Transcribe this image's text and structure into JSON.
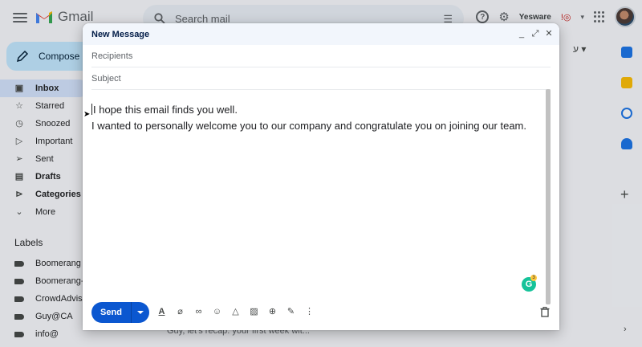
{
  "app": {
    "logo_text": "Gmail",
    "search_placeholder": "Search mail",
    "yesware_label": "Yesware"
  },
  "sidebar": {
    "compose_label": "Compose",
    "items": [
      {
        "label": "Inbox",
        "icon": "inbox-icon",
        "active": true
      },
      {
        "label": "Starred",
        "icon": "star-icon"
      },
      {
        "label": "Snoozed",
        "icon": "clock-icon"
      },
      {
        "label": "Important",
        "icon": "important-icon"
      },
      {
        "label": "Sent",
        "icon": "send-icon"
      },
      {
        "label": "Drafts",
        "icon": "draft-icon",
        "bold": true
      },
      {
        "label": "Categories",
        "icon": "categories-icon",
        "bold": true
      },
      {
        "label": "More",
        "icon": "chevron-down-icon"
      }
    ],
    "labels_heading": "Labels",
    "labels": [
      "Boomerang",
      "Boomerang-C",
      "CrowdAdvise",
      "Guy@CA",
      "info@"
    ]
  },
  "background": {
    "hint_text": "ע ▾",
    "row_preview": "Guy, let's recap: your first week wit..."
  },
  "compose": {
    "title": "New Message",
    "recipients_placeholder": "Recipients",
    "subject_placeholder": "Subject",
    "body_line1": "I hope this email finds you well.",
    "body_line2": "I wanted to personally welcome you to our company and congratulate you on joining our team.",
    "send_label": "Send",
    "grammarly_letter": "G",
    "grammarly_count": "3"
  },
  "colors": {
    "accent": "#0b57d0",
    "compose_button": "#c2e7ff",
    "active_nav": "#d3e3fd"
  }
}
